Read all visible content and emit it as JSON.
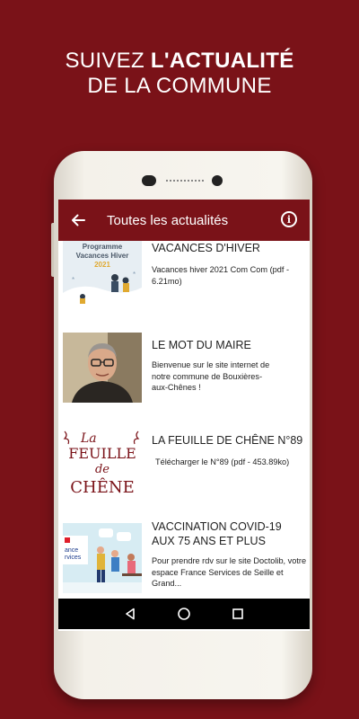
{
  "promo": {
    "line1_regular": "SUIVEZ ",
    "line1_bold": "L'ACTUALITÉ",
    "line2": "DE LA COMMUNE"
  },
  "appbar": {
    "title": "Toutes les actualités",
    "back_icon": "arrow-left-icon",
    "info_icon": "info-icon",
    "info_glyph": "i"
  },
  "colors": {
    "brand": "#7a1218",
    "background": "#ffffff"
  },
  "news": [
    {
      "title": "VACANCES D'HIVER",
      "description": "Vacances hiver 2021 Com Com (pdf - 6.21mo)",
      "thumb_text": [
        "Programme",
        "Vacances Hiver",
        "2021"
      ]
    },
    {
      "title": "LE MOT DU MAIRE",
      "description": "Bienvenue sur le site internet de notre commune de Bouxières-aux-Chênes !"
    },
    {
      "title": "LA FEUILLE DE CHÊNE N°89",
      "description": "Télécharger le N°89 (pdf - 453.89ko)",
      "thumb_text": [
        "La",
        "FEUILLE",
        "de",
        "CHÊNE"
      ]
    },
    {
      "title": "VACCINATION COVID-19 AUX 75 ANS ET PLUS",
      "description": "Pour prendre rdv sur le site Doctolib, votre espace France Services de Seille et Grand...",
      "thumb_text": [
        "ance",
        "rvices"
      ]
    }
  ],
  "navbar": {
    "back": "triangle-back-icon",
    "home": "circle-home-icon",
    "recents": "square-recents-icon"
  }
}
